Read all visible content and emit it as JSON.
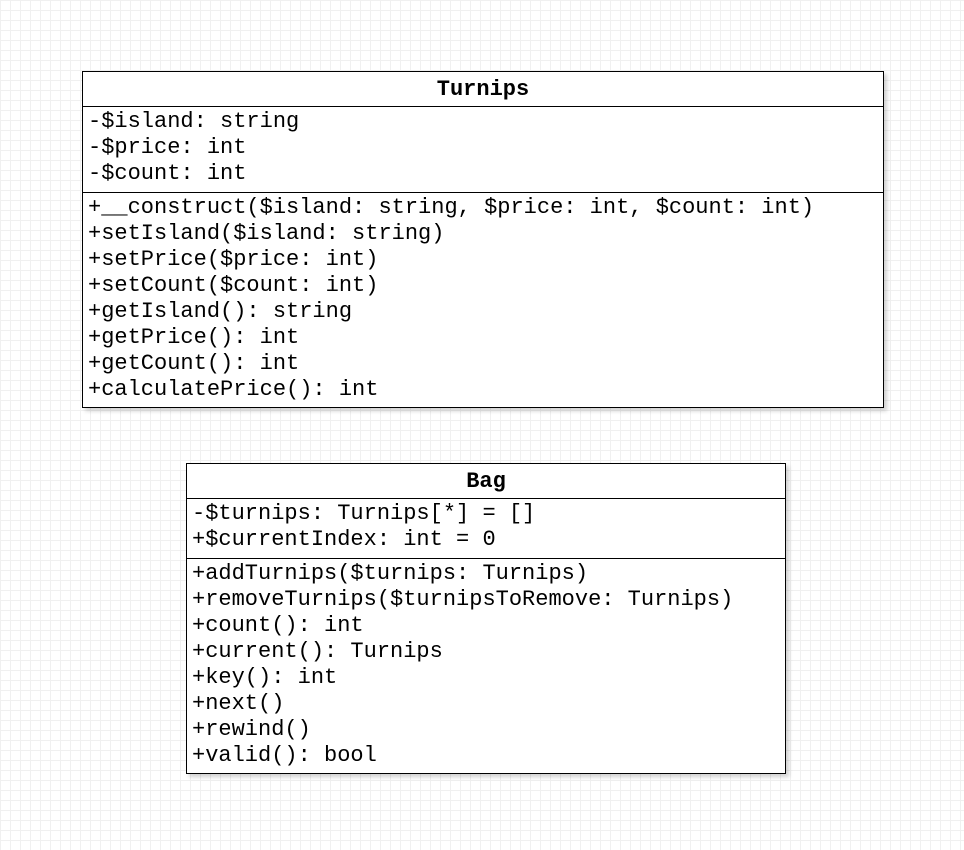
{
  "classes": [
    {
      "name": "Turnips",
      "attributes": [
        "-$island: string",
        "-$price: int",
        "-$count: int"
      ],
      "methods": [
        "+__construct($island: string, $price: int, $count: int)",
        "+setIsland($island: string)",
        "+setPrice($price: int)",
        "+setCount($count: int)",
        "+getIsland(): string",
        "+getPrice(): int",
        "+getCount(): int",
        "+calculatePrice(): int"
      ]
    },
    {
      "name": "Bag",
      "attributes": [
        "-$turnips: Turnips[*] = []",
        "+$currentIndex: int = 0"
      ],
      "methods": [
        "+addTurnips($turnips: Turnips)",
        "+removeTurnips($turnipsToRemove: Turnips)",
        "+count(): int",
        "+current(): Turnips",
        "+key(): int",
        "+next()",
        "+rewind()",
        "+valid(): bool"
      ]
    }
  ]
}
